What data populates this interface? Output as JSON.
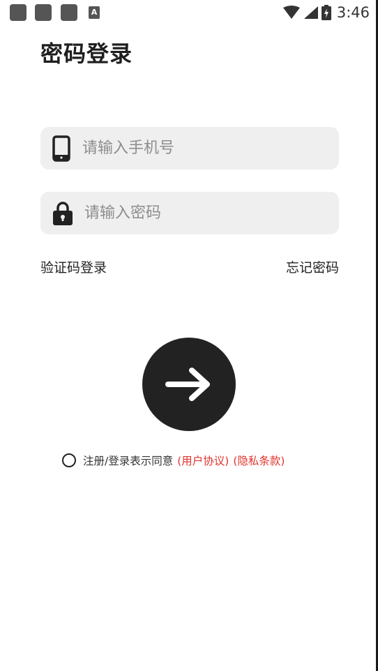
{
  "status_bar": {
    "time": "3:46",
    "notification_icon_letter": "A",
    "icons": [
      "notification-icon",
      "notification-icon",
      "notification-icon",
      "a-icon",
      "wifi-icon",
      "signal-icon",
      "battery-icon"
    ]
  },
  "page": {
    "title": "密码登录"
  },
  "phone_field": {
    "placeholder": "请输入手机号",
    "value": "",
    "icon": "smartphone-icon"
  },
  "password_field": {
    "placeholder": "请输入密码",
    "value": "",
    "icon": "lock-icon"
  },
  "links": {
    "sms_login": "验证码登录",
    "forgot_password": "忘记密码"
  },
  "submit": {
    "icon": "arrow-right-icon",
    "color": "#222222"
  },
  "agreement": {
    "text": "注册/登录表示同意",
    "user_agreement": "(用户协议)",
    "privacy_policy": "(隐私条款)",
    "checked": false,
    "link_color": "#e0332c"
  }
}
